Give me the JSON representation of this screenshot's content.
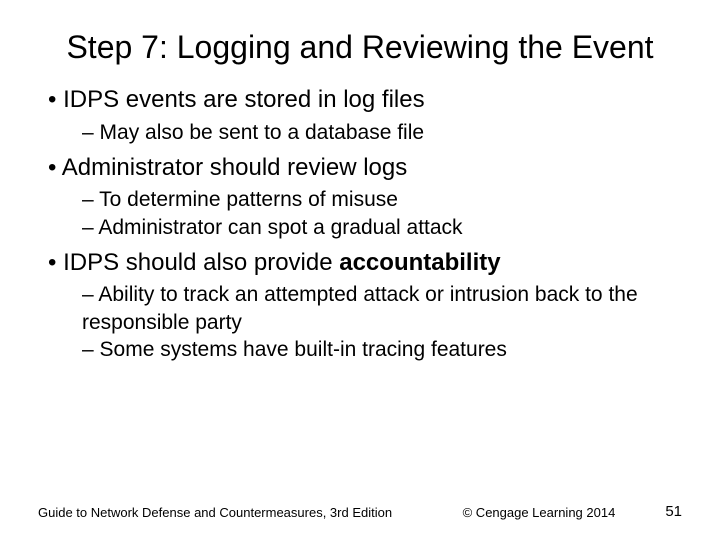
{
  "title": "Step 7: Logging and Reviewing the Event",
  "b1": "IDPS events are stored in log files",
  "b1s1": "May also be sent to a database file",
  "b2": "Administrator should review logs",
  "b2s1": "To determine patterns of misuse",
  "b2s2": "Administrator can spot a gradual attack",
  "b3a": "IDPS should also provide ",
  "b3b": "accountability",
  "b3s1": "Ability to track an attempted attack or intrusion back to the responsible party",
  "b3s2": "Some systems have built-in tracing features",
  "footer_left": "Guide to Network Defense and Countermeasures, 3rd Edition",
  "footer_mid": "© Cengage Learning 2014",
  "footer_right": "51"
}
